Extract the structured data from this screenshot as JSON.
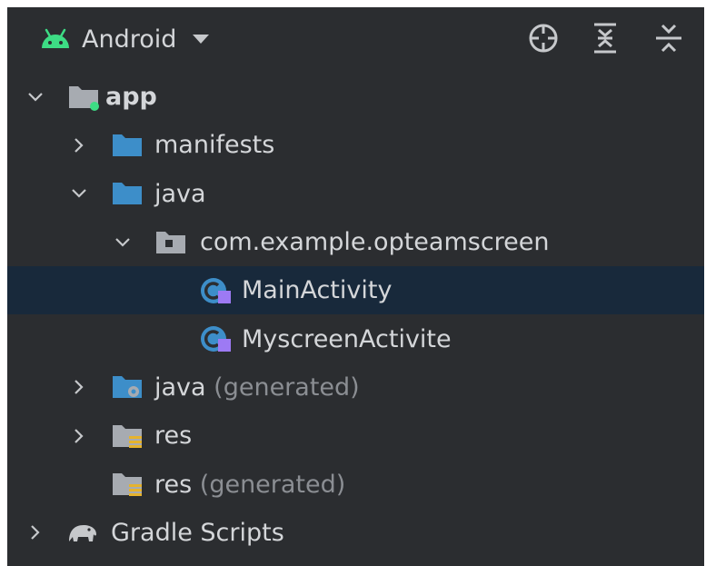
{
  "toolbar": {
    "view_name": "Android",
    "icons": [
      "locate-icon",
      "expand-all-icon",
      "collapse-all-icon"
    ]
  },
  "tree": {
    "app": "app",
    "manifests": "manifests",
    "java": "java",
    "package": "com.example.opteamscreen",
    "main_activity": "MainActivity",
    "myscreen_activity": "MyscreenActivite",
    "java_generated": "java",
    "java_generated_suffix": "(generated)",
    "res": "res",
    "res_generated": "res",
    "res_generated_suffix": "(generated)",
    "gradle": "Gradle Scripts"
  },
  "colors": {
    "panel_bg": "#2b2d30",
    "selection": "#18293b",
    "text": "#d4d6d9",
    "muted_text": "#8b8e93",
    "android_green": "#3ddc84",
    "folder_blue": "#3d8ec9",
    "kotlin_purple": "#9d7af4",
    "resource_yellow": "#e6b32d"
  }
}
